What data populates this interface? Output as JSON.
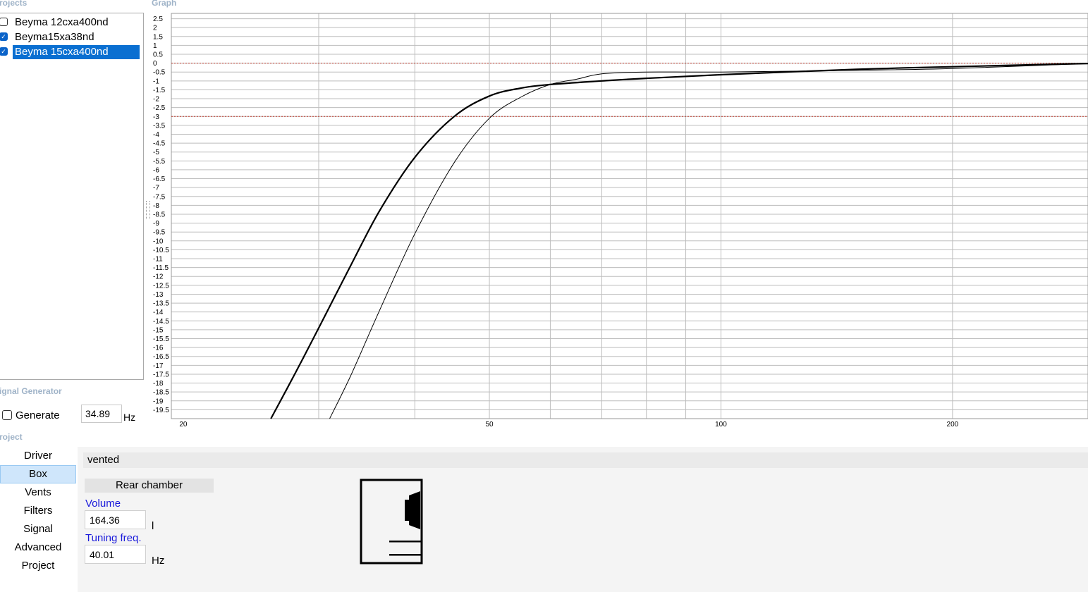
{
  "projects": {
    "title": "rojects",
    "items": [
      {
        "label": "Beyma 12cxa400nd",
        "checked": false,
        "selected": false
      },
      {
        "label": "Beyma15xa38nd",
        "checked": true,
        "selected": false
      },
      {
        "label": "Beyma 15cxa400nd",
        "checked": true,
        "selected": true
      }
    ]
  },
  "graph": {
    "title": "Graph"
  },
  "signal_generator": {
    "title": "ignal Generator",
    "generate_label": "Generate",
    "generate_checked": false,
    "frequency": "34.89",
    "unit": "Hz"
  },
  "project": {
    "title": "roject",
    "nav": [
      {
        "label": "Driver",
        "active": false
      },
      {
        "label": "Box",
        "active": true
      },
      {
        "label": "Vents",
        "active": false
      },
      {
        "label": "Filters",
        "active": false
      },
      {
        "label": "Signal",
        "active": false
      },
      {
        "label": "Advanced",
        "active": false
      },
      {
        "label": "Project",
        "active": false
      }
    ],
    "box_type": "vented",
    "rear_chamber": {
      "header": "Rear chamber",
      "volume_label": "Volume",
      "volume": "164.36",
      "volume_unit": "l",
      "tuning_label": "Tuning freq.",
      "tuning": "40.01",
      "tuning_unit": "Hz"
    }
  },
  "chart_data": {
    "type": "line",
    "title": "",
    "xlabel": "",
    "ylabel": "",
    "x_scale": "log",
    "xlim": [
      19.3,
      300
    ],
    "ylim": [
      -20,
      2.8
    ],
    "y_ticks": [
      "2.5",
      "2",
      "1.5",
      "1",
      "0.5",
      "0",
      "-0.5",
      "-1",
      "-1.5",
      "-2",
      "-2.5",
      "-3",
      "-3.5",
      "-4",
      "-4.5",
      "-5",
      "-5.5",
      "-6",
      "-6.5",
      "-7",
      "-7.5",
      "-8",
      "-8.5",
      "-9",
      "-9.5",
      "-10",
      "-10.5",
      "-11",
      "-11.5",
      "-12",
      "-12.5",
      "-13",
      "-13.5",
      "-14",
      "-14.5",
      "-15",
      "-15.5",
      "-16",
      "-16.5",
      "-17",
      "-17.5",
      "-18",
      "-18.5",
      "-19",
      "-19.5"
    ],
    "x_tick_labels": [
      {
        "label": "20",
        "value": 20
      },
      {
        "label": "50",
        "value": 50
      },
      {
        "label": "100",
        "value": 100
      },
      {
        "label": "200",
        "value": 200
      }
    ],
    "x_gridlines": [
      30,
      40,
      50,
      60,
      70,
      80,
      90,
      100,
      200,
      300
    ],
    "reference_lines": [
      0,
      -3
    ],
    "grid": true,
    "series": [
      {
        "width": 2.2,
        "x": [
          26,
          28,
          30,
          33,
          36,
          40,
          45,
          50,
          55,
          60,
          70,
          80,
          100,
          150,
          200,
          300
        ],
        "y": [
          -20,
          -17.4,
          -14.9,
          -11.4,
          -8.3,
          -5.3,
          -3.0,
          -1.85,
          -1.4,
          -1.2,
          -1.0,
          -0.85,
          -0.65,
          -0.35,
          -0.2,
          -0.02
        ]
      },
      {
        "width": 1.0,
        "x": [
          31,
          33,
          36,
          40,
          45,
          50,
          55,
          60,
          65,
          70,
          80,
          100,
          150,
          200,
          300
        ],
        "y": [
          -20,
          -17.6,
          -13.9,
          -9.6,
          -5.6,
          -3.1,
          -1.9,
          -1.2,
          -0.9,
          -0.6,
          -0.5,
          -0.5,
          -0.4,
          -0.3,
          -0.02
        ]
      }
    ]
  }
}
